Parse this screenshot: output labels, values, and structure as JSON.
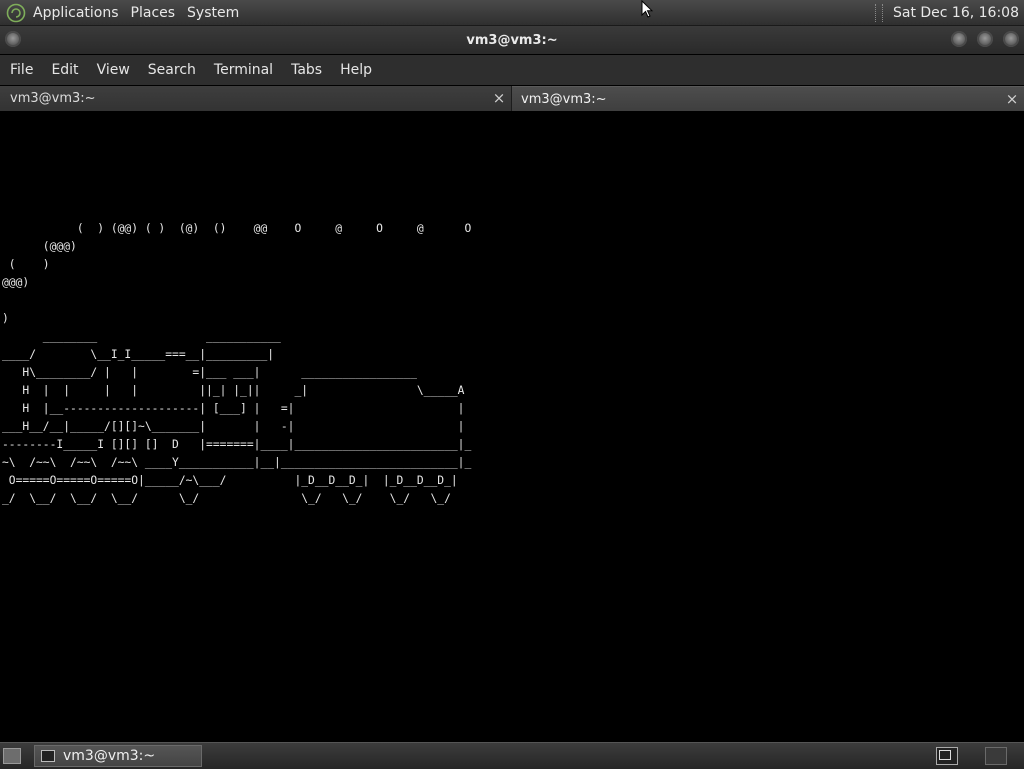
{
  "top_panel": {
    "menus": [
      "Applications",
      "Places",
      "System"
    ],
    "clock": "Sat Dec 16, 16:08"
  },
  "window": {
    "title": "vm3@vm3:~"
  },
  "menubar": {
    "items": [
      "File",
      "Edit",
      "View",
      "Search",
      "Terminal",
      "Tabs",
      "Help"
    ]
  },
  "tabs": [
    {
      "label": "vm3@vm3:~",
      "close": "×",
      "active": false
    },
    {
      "label": "vm3@vm3:~",
      "close": "×",
      "active": true
    }
  ],
  "terminal": {
    "lines": [
      "",
      "",
      "",
      "",
      "",
      "",
      "           (  ) (@@) ( )  (@)  ()    @@    O     @     O     @      O",
      "      (@@@)",
      " (    )",
      "@@@)",
      "",
      ")",
      "      ________                ___________",
      "____/        \\__I_I_____===__|_________|",
      "   H\\________/ |   |        =|___ ___|      _________________",
      "   H  |  |     |   |         ||_| |_||     _|                \\_____A",
      "   H  |__--------------------| [___] |   =|                        |",
      "___H__/__|_____/[][]~\\_______|       |   -|                        |",
      "--------I_____I [][] []  D   |=======|____|________________________|_",
      "~\\  /~~\\  /~~\\  /~~\\ ____Y___________|__|__________________________|_",
      " O=====O=====O=====O|_____/~\\___/          |_D__D__D_|  |_D__D__D_|",
      "_/  \\__/  \\__/  \\__/      \\_/               \\_/   \\_/    \\_/   \\_/"
    ]
  },
  "taskbar": {
    "window_label": "vm3@vm3:~"
  },
  "colors": {
    "panel": "#3a3a3a",
    "terminal_bg": "#000000",
    "terminal_fg": "#e8e8e8"
  }
}
